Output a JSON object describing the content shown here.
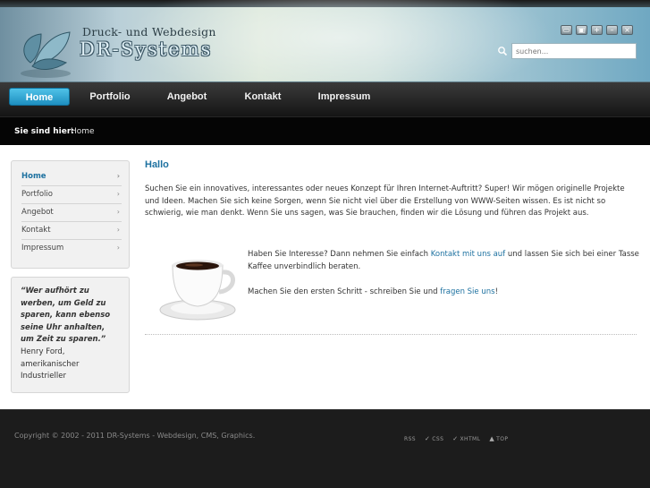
{
  "brand": {
    "subtitle": "Druck- und Webdesign",
    "title": "DR-Systems"
  },
  "toolbar": {
    "icons": [
      "minimize-icon",
      "restore-icon",
      "zoom-in-icon",
      "zoom-out-icon",
      "close-icon"
    ],
    "glyphs": [
      "▭",
      "▣",
      "+",
      "–",
      "×"
    ]
  },
  "search": {
    "placeholder": "suchen..."
  },
  "nav": {
    "items": [
      "Home",
      "Portfolio",
      "Angebot",
      "Kontakt",
      "Impressum"
    ],
    "active": "Home"
  },
  "breadcrumb": {
    "label": "Sie sind hier:",
    "current": "Home"
  },
  "sidebar": {
    "items": [
      "Home",
      "Portfolio",
      "Angebot",
      "Kontakt",
      "Impressum"
    ],
    "arrow": "›"
  },
  "quote": {
    "text": "“Wer aufhört zu werben, um Geld zu sparen, kann ebenso seine Uhr anhalten, um Zeit zu sparen.”",
    "author": "Henry Ford, amerikanischer Industrieller"
  },
  "content": {
    "heading": "Hallo",
    "intro": "Suchen Sie ein innovatives, interessantes oder neues Konzept für Ihren Internet-Auftritt? Super! Wir mögen originelle Projekte und Ideen. Machen Sie sich keine Sorgen, wenn Sie nicht viel über die Erstellung von WWW-Seiten wissen. Es ist nicht so schwierig, wie man denkt. Wenn Sie uns sagen, was Sie brauchen, finden wir die Lösung und führen das Projekt aus.",
    "cta1_before": "Haben Sie Interesse? Dann nehmen Sie einfach ",
    "cta1_link": "Kontakt mit uns auf",
    "cta1_after": " und lassen Sie sich bei einer Tasse Kaffee unverbindlich beraten.",
    "cta2_before": "Machen Sie den ersten Schritt - schreiben Sie und ",
    "cta2_link": "fragen Sie uns",
    "cta2_after": "!"
  },
  "footer": {
    "copyright": "Copyright © 2002 - 2011 DR-Systems - Webdesign, CMS, Graphics.",
    "links": [
      "RSS",
      "CSS",
      "XHTML",
      "TOP"
    ]
  },
  "colors": {
    "accent": "#1d71a0",
    "nav_active": "#2ba3d6",
    "footer_bg": "#1c1c1c"
  }
}
